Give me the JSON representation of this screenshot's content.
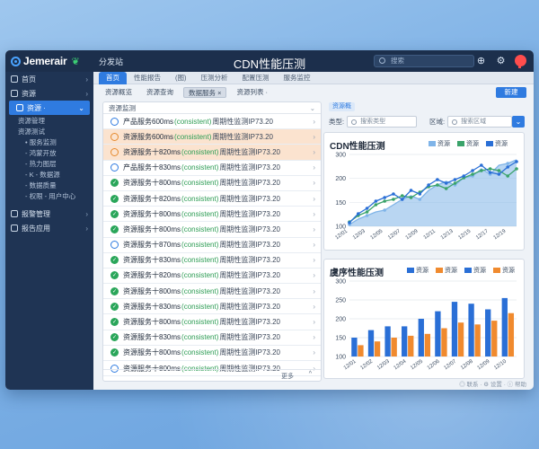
{
  "app": {
    "name": "Jemerair",
    "menu": "分发站",
    "title": "CDN性能压测"
  },
  "search": {
    "placeholder": "搜索"
  },
  "sidebar": {
    "items": [
      {
        "label": "首页"
      },
      {
        "label": "资源"
      }
    ],
    "active": {
      "label": "资源 ·"
    },
    "subs": [
      {
        "label": "资源管理",
        "indent": 1
      },
      {
        "label": "资源测试",
        "indent": 1
      },
      {
        "label": "• 服务监测",
        "indent": 2
      },
      {
        "label": "- 鸿蒙开放",
        "indent": 2
      },
      {
        "label": "- 热力图层",
        "indent": 2
      },
      {
        "label": "- K - 数据源",
        "indent": 2
      },
      {
        "label": "- 数据质量",
        "indent": 2
      },
      {
        "label": "- 权限 - 用户中心",
        "indent": 2
      }
    ],
    "bottom": [
      {
        "label": "报警管理"
      },
      {
        "label": "报告应用"
      }
    ]
  },
  "tabs": [
    "首页",
    "性能报告",
    "(图)",
    "压测分析",
    "配置压测",
    "服务监控"
  ],
  "subtabs": [
    "资源概览",
    "资源查询",
    "数据服务 ×",
    "资源列表 ·"
  ],
  "subtab_selected": 2,
  "action_button": "新建",
  "list": {
    "header": "资源监测",
    "rows": [
      {
        "icon": "blue",
        "t1": "产品服务 ",
        "v": "600",
        "u": "ms",
        "tag": "(consistent)",
        "t2": "周期性监测",
        "t3": "IP73.20",
        "hl": false
      },
      {
        "icon": "orange",
        "t1": "资源服务 ",
        "v": "600",
        "u": "ms",
        "tag": "(consistent)",
        "t2": "周期性监测",
        "t3": "IP73.20",
        "hl": true
      },
      {
        "icon": "orange",
        "t1": "资源服务十 ",
        "v": "820",
        "u": "ms",
        "tag": "(consistent)",
        "t2": "周期性监测",
        "t3": "IP73.20",
        "hl": true
      },
      {
        "icon": "blue",
        "t1": "产品服务十 ",
        "v": "830",
        "u": "ms",
        "tag": "(consistent)",
        "t2": "周期性监测",
        "t3": "IP73.20",
        "hl": false
      },
      {
        "icon": "green",
        "t1": "资源服务十 ",
        "v": "800",
        "u": "ms",
        "tag": "(consistent)",
        "t2": "周期性监测",
        "t3": "IP73.20",
        "hl": false
      },
      {
        "icon": "green",
        "t1": "资源服务十 ",
        "v": "820",
        "u": "ms",
        "tag": "(consistent)",
        "t2": "周期性监测",
        "t3": "IP73.20",
        "hl": false
      },
      {
        "icon": "green",
        "t1": "资源服务十 ",
        "v": "800",
        "u": "ms",
        "tag": "(consistent)",
        "t2": "周期性监测",
        "t3": "IP73.20",
        "hl": false
      },
      {
        "icon": "green",
        "t1": "资源服务十 ",
        "v": "800",
        "u": "ms",
        "tag": "(consistent)",
        "t2": "周期性监测",
        "t3": "IP73.20",
        "hl": false
      },
      {
        "icon": "blue",
        "t1": "资源服务十 ",
        "v": "870",
        "u": "ms",
        "tag": "(consistent)",
        "t2": "周期性监测",
        "t3": "IP73.20",
        "hl": false
      },
      {
        "icon": "green",
        "t1": "资源服务十 ",
        "v": "830",
        "u": "ms",
        "tag": "(consistent)",
        "t2": "周期性监测",
        "t3": "IP73.20",
        "hl": false
      },
      {
        "icon": "green",
        "t1": "资源服务十 ",
        "v": "820",
        "u": "ms",
        "tag": "(consistent)",
        "t2": "周期性监测",
        "t3": "IP73.20",
        "hl": false
      },
      {
        "icon": "green",
        "t1": "资源服务十 ",
        "v": "800",
        "u": "ms",
        "tag": "(consistent)",
        "t2": "周期性监测",
        "t3": "IP73.20",
        "hl": false
      },
      {
        "icon": "green",
        "t1": "资源服务十 ",
        "v": "830",
        "u": "ms",
        "tag": "(consistent)",
        "t2": "周期性监测",
        "t3": "IP73.20",
        "hl": false
      },
      {
        "icon": "green",
        "t1": "资源服务十 ",
        "v": "800",
        "u": "ms",
        "tag": "(consistent)",
        "t2": "周期性监测",
        "t3": "IP73.20",
        "hl": false
      },
      {
        "icon": "green",
        "t1": "资源服务十 ",
        "v": "830",
        "u": "ms",
        "tag": "(consistent)",
        "t2": "周期性监测",
        "t3": "IP73.20",
        "hl": false
      },
      {
        "icon": "green",
        "t1": "资源服务十 ",
        "v": "800",
        "u": "ms",
        "tag": "(consistent)",
        "t2": "周期性监测",
        "t3": "IP73.20",
        "hl": false
      },
      {
        "icon": "blue",
        "t1": "资源服务十 ",
        "v": "800",
        "u": "ms",
        "tag": "(consistent)",
        "t2": "周期性监测",
        "t3": "IP73.20",
        "hl": false
      }
    ],
    "footer_label": "更多",
    "footer_up": "^"
  },
  "right": {
    "tab": "资源概",
    "filter1_label": "类型:",
    "filter1_placeholder": "搜索类型",
    "filter2_label": "区域:",
    "filter2_placeholder": "搜索区域"
  },
  "status": "◎ 联系 · ⚙ 设置 · ⓘ 帮助",
  "colors": {
    "accent": "#2f7be0",
    "green": "#3aa36a",
    "orange": "#f08a2e",
    "blue_fill": "#7fb4e8"
  },
  "chart_data": [
    {
      "type": "line",
      "title": "CDN性能压测",
      "legend": [
        "资源",
        "资源",
        "资源"
      ],
      "y_ticks": [
        "300",
        "200",
        "150",
        "100"
      ],
      "ylim": [
        100,
        300
      ],
      "x": [
        "12/01",
        "12/02",
        "12/03",
        "12/04",
        "12/05",
        "12/06",
        "12/07",
        "12/08",
        "12/09",
        "12/10",
        "12/11",
        "12/12",
        "12/13",
        "12/14",
        "12/15",
        "12/16",
        "12/17",
        "12/18",
        "12/19",
        "12/20"
      ],
      "series": [
        {
          "name": "资源",
          "color": "#7fb4e8",
          "values": [
            105,
            120,
            130,
            140,
            145,
            160,
            175,
            185,
            175,
            200,
            215,
            225,
            215,
            235,
            240,
            260,
            245,
            270,
            275,
            285
          ],
          "area": true
        },
        {
          "name": "资源",
          "color": "#3aa36a",
          "values": [
            112,
            130,
            140,
            160,
            170,
            175,
            185,
            180,
            195,
            210,
            215,
            205,
            220,
            235,
            245,
            255,
            260,
            255,
            240,
            260
          ]
        },
        {
          "name": "资源",
          "color": "#2a6fd6",
          "values": [
            110,
            135,
            150,
            170,
            180,
            190,
            175,
            200,
            190,
            215,
            230,
            220,
            230,
            240,
            255,
            270,
            250,
            245,
            265,
            280
          ]
        }
      ]
    },
    {
      "type": "bar",
      "title": "虞序性能压测",
      "legend": [
        "资源",
        "资源",
        "资源",
        "资源"
      ],
      "y_ticks": [
        "300",
        "250",
        "200",
        "150",
        "100"
      ],
      "ylim": [
        100,
        300
      ],
      "categories": [
        "12/01",
        "12/02",
        "12/03",
        "12/04",
        "12/05",
        "12/06",
        "12/07",
        "12/08",
        "12/09",
        "12/10"
      ],
      "series": [
        {
          "name": "资源",
          "color": "#2a6fd6",
          "values": [
            150,
            170,
            180,
            180,
            200,
            220,
            245,
            240,
            225,
            255
          ]
        },
        {
          "name": "资源",
          "color": "#f08a2e",
          "values": [
            130,
            140,
            150,
            155,
            160,
            175,
            190,
            185,
            195,
            215
          ]
        }
      ]
    }
  ]
}
